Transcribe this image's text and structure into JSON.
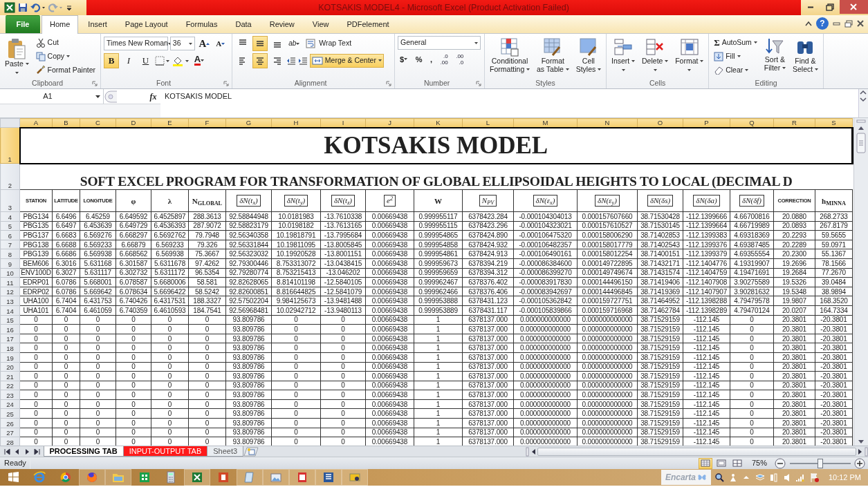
{
  "title_bar": {
    "title": "KOTSAKIS MODEL4  -  Microsoft Excel (Product Activation Failed)"
  },
  "menu_tabs": [
    {
      "label": "File",
      "kind": "file",
      "selected": false
    },
    {
      "label": "Home",
      "kind": "tab",
      "selected": true
    },
    {
      "label": "Insert",
      "kind": "tab",
      "selected": false
    },
    {
      "label": "Page Layout",
      "kind": "tab",
      "selected": false
    },
    {
      "label": "Formulas",
      "kind": "tab",
      "selected": false
    },
    {
      "label": "Data",
      "kind": "tab",
      "selected": false
    },
    {
      "label": "Review",
      "kind": "tab",
      "selected": false
    },
    {
      "label": "View",
      "kind": "tab",
      "selected": false
    },
    {
      "label": "PDFelement",
      "kind": "tab",
      "selected": false
    }
  ],
  "ribbon": {
    "clipboard": {
      "label": "Clipboard",
      "paste": "Paste",
      "cut": "Cut",
      "copy": "Copy",
      "format_painter": "Format Painter"
    },
    "font": {
      "label": "Font",
      "font_name": "Times New Roman",
      "font_size": "36",
      "grow_glyph": "A",
      "shrink_glyph": "A",
      "bold_glyph": "B",
      "italic_glyph": "I",
      "underline_glyph": "U",
      "color_glyph": "A",
      "bold": true,
      "italic": false,
      "underline": false
    },
    "alignment": {
      "label": "Alignment",
      "vertical": [
        {
          "selected": false
        },
        {
          "selected": true
        },
        {
          "selected": false
        }
      ],
      "horizontal": [
        {
          "selected": false
        },
        {
          "selected": true
        },
        {
          "selected": false
        }
      ],
      "orientation_glyph": "ab",
      "wrap_text": "Wrap Text",
      "wrap_on": false,
      "merge_center": "Merge & Center",
      "merge_on": true
    },
    "number": {
      "label": "Number",
      "format": "General",
      "currency": "$",
      "percent": "%",
      "comma": ",",
      "increase_decimal": [
        ".0",
        ".00"
      ],
      "decrease_decimal": [
        ".00",
        ".0"
      ]
    },
    "styles": {
      "label": "Styles",
      "buttons": [
        [
          "Conditional",
          "Formatting"
        ],
        [
          "Format",
          "as Table"
        ],
        [
          "Cell",
          "Styles"
        ]
      ]
    },
    "cells": {
      "label": "Cells",
      "buttons": [
        "Insert",
        "Delete",
        "Format"
      ]
    },
    "editing": {
      "label": "Editing",
      "autosum_glyph": "Σ",
      "autosum": "AutoSum",
      "fill": "Fill",
      "clear": "Clear",
      "sort": [
        "Sort &",
        "Filter"
      ],
      "find": [
        "Find &",
        "Select"
      ]
    }
  },
  "help": "?",
  "formula_bar": {
    "name_box": "A1",
    "function_glyph": "fx",
    "formula": "KOTSAKIS MODEL"
  },
  "columns": [
    {
      "letter": "A",
      "selected": true
    },
    {
      "letter": "B",
      "selected": true
    },
    {
      "letter": "C",
      "selected": true
    },
    {
      "letter": "D",
      "selected": true
    },
    {
      "letter": "E",
      "selected": true
    },
    {
      "letter": "F",
      "selected": true
    },
    {
      "letter": "G",
      "selected": true
    },
    {
      "letter": "H",
      "selected": true
    },
    {
      "letter": "I",
      "selected": true
    },
    {
      "letter": "J",
      "selected": true
    },
    {
      "letter": "K",
      "selected": true
    },
    {
      "letter": "L",
      "selected": true
    },
    {
      "letter": "M",
      "selected": true
    },
    {
      "letter": "N",
      "selected": true
    },
    {
      "letter": "O",
      "selected": true
    },
    {
      "letter": "P",
      "selected": true
    },
    {
      "letter": "Q",
      "selected": true
    },
    {
      "letter": "R",
      "selected": true
    },
    {
      "letter": "S",
      "selected": true
    }
  ],
  "rows": [
    {
      "number": "1",
      "selected": true,
      "kind": "title",
      "text": "KOTSAKIS MODEL"
    },
    {
      "number": "2",
      "selected": false,
      "kind": "subtitle",
      "text": "SOFT EXCEL PROGRAM FOR TRANSFORMATION OF GLOBAL ELLIPSOIDAL  HEIGHTS TO LOCAL  (DECIMAL D"
    },
    {
      "number": "3",
      "selected": false,
      "kind": "header",
      "cells": [
        {
          "text": "STATION",
          "kind": "label"
        },
        {
          "text": "LATITUDE",
          "kind": "label"
        },
        {
          "text": "LONGITUDE",
          "kind": "label"
        },
        {
          "text": "φ",
          "kind": "symbol"
        },
        {
          "text": "λ",
          "kind": "symbol"
        },
        {
          "text": "N$_{GLOBAL}$",
          "kind": "symbol"
        },
        {
          "text": "δN(t$_{x}$)",
          "kind": "equation"
        },
        {
          "text": "δN(t$_{y}$)",
          "kind": "equation"
        },
        {
          "text": "δN(t$_{z}$)",
          "kind": "equation"
        },
        {
          "text": "e$^{2}$",
          "kind": "equation"
        },
        {
          "text": "W",
          "kind": "symbol"
        },
        {
          "text": "N$_{PV}$",
          "kind": "equation"
        },
        {
          "text": "δN(ε$_{x}$)",
          "kind": "equation"
        },
        {
          "text": "δN(ε$_{y}$)",
          "kind": "equation"
        },
        {
          "text": "δN(δs)",
          "kind": "equation"
        },
        {
          "text": "δN(δa)",
          "kind": "equation"
        },
        {
          "text": "δN(δf)",
          "kind": "equation"
        },
        {
          "text": "CORRECTION",
          "kind": "label"
        },
        {
          "text": "h$_{MINNA}$",
          "kind": "symbol"
        }
      ]
    },
    {
      "number": "4",
      "selected": false,
      "kind": "data",
      "cells": [
        "PBG134",
        "6.6496",
        "6.45259",
        "6.649592",
        "6.4525897",
        "288.3613",
        "92.58844948",
        "10.0181983",
        "-13.7610338",
        "0.00669438",
        "0.999955117",
        "6378423.284",
        "-0.000104304013",
        "0.000157607660",
        "38.71530428",
        "-112.1399666",
        "4.66700816",
        "20.0880",
        "268.2733"
      ]
    },
    {
      "number": "5",
      "selected": false,
      "kind": "data",
      "cells": [
        "PBG135",
        "6.6497",
        "6.453639",
        "6.649729",
        "6.4536393",
        "287.9072",
        "92.58823179",
        "10.0198182",
        "-13.7613165",
        "0.00669438",
        "0.999955115",
        "6378423.296",
        "-0.000104323021",
        "0.000157610527",
        "38.71530145",
        "-112.1399664",
        "4.66719989",
        "20.0893",
        "267.8179"
      ]
    },
    {
      "number": "6",
      "selected": false,
      "kind": "data",
      "cells": [
        "PBG137",
        "6.6683",
        "6.569276",
        "6.668297",
        "6.5692762",
        "79.7948",
        "92.56340358",
        "10.19818791",
        "-13.7995684",
        "0.00669438",
        "0.999954865",
        "6378424.890",
        "-0.000106475320",
        "0.000158006290",
        "38.71402853",
        "-112.1399383",
        "4.69318369",
        "20.2293",
        "59.5655"
      ]
    },
    {
      "number": "7",
      "selected": false,
      "kind": "data",
      "cells": [
        "PBG138",
        "6.6688",
        "6.569233",
        "6.66879",
        "6.569233",
        "79.326",
        "92.56331844",
        "10.19811095",
        "-13.8005845",
        "0.00669438",
        "0.999954858",
        "6378424.932",
        "-0.000106482357",
        "0.000158017779",
        "38.71402543",
        "-112.1399376",
        "4.69387485",
        "20.2289",
        "59.0971"
      ]
    },
    {
      "number": "8",
      "selected": false,
      "kind": "data",
      "cells": [
        "PBG139",
        "6.6686",
        "6.569938",
        "6.668562",
        "6.569938",
        "75.3667",
        "92.56323032",
        "10.19920528",
        "-13.8001151",
        "0.00669438",
        "0.999954861",
        "6378424.913",
        "-0.000106490161",
        "0.000158012254",
        "38.71400151",
        "-112.1399379",
        "4.69355554",
        "20.2300",
        "55.1367"
      ]
    },
    {
      "number": "9",
      "selected": false,
      "kind": "data",
      "cells": [
        "BEM606",
        "6.3016",
        "5.631168",
        "6.301587",
        "5.6311678",
        "97.4262",
        "92.79300446",
        "8.753313072",
        "-13.0438415",
        "0.00669438",
        "0.999959673",
        "6378394.219",
        "-0.000086384600",
        "0.000149722895",
        "38.71432171",
        "-112.1404776",
        "4.19319907",
        "19.2696",
        "78.1566"
      ]
    },
    {
      "number": "10",
      "selected": false,
      "kind": "data",
      "cells": [
        "ENV100D",
        "6.3027",
        "5.631117",
        "6.302732",
        "5.6311172",
        "96.5354",
        "92.79280774",
        "8.753215413",
        "-13.046202",
        "0.00669438",
        "0.999959659",
        "6378394.312",
        "-0.000086399270",
        "0.000149749674",
        "38.71431574",
        "-112.1404759",
        "4.19471691",
        "19.2684",
        "77.2670"
      ]
    },
    {
      "number": "11",
      "selected": false,
      "kind": "data",
      "cells": [
        "EDRP01",
        "6.0786",
        "5.668001",
        "6.078587",
        "5.6680006",
        "58.581",
        "92.82628065",
        "8.814101198",
        "-12.5840105",
        "0.00669438",
        "0.999962467",
        "6378376.402",
        "-0.000083917830",
        "0.000144496150",
        "38.71419406",
        "-112.1407908",
        "3.90275589",
        "19.5326",
        "39.0484"
      ]
    },
    {
      "number": "12",
      "selected": false,
      "kind": "data",
      "cells": [
        "EDRP02",
        "6.0786",
        "5.669642",
        "6.078634",
        "5.6696422",
        "58.5242",
        "92.82600851",
        "8.816644825",
        "-12.5841079",
        "0.00669438",
        "0.999962466",
        "6378376.406",
        "-0.000083942697",
        "0.000144496845",
        "38.71419369",
        "-112.1407907",
        "3.90281632",
        "19.5348",
        "38.9894"
      ]
    },
    {
      "number": "13",
      "selected": false,
      "kind": "data",
      "cells": [
        "UHA100",
        "6.7404",
        "6.431753",
        "6.740426",
        "6.4317531",
        "188.3327",
        "92.57502204",
        "9.984125673",
        "-13.9481488",
        "0.00669438",
        "0.999953888",
        "6378431.123",
        "-0.000105362842",
        "0.000159727751",
        "38.71464952",
        "-112.1398288",
        "4.79479578",
        "19.9807",
        "168.3520"
      ]
    },
    {
      "number": "14",
      "selected": false,
      "kind": "data",
      "cells": [
        "UHA101",
        "6.7404",
        "6.461059",
        "6.740359",
        "6.4610593",
        "184.7541",
        "92.56968481",
        "10.02942712",
        "-13.9480113",
        "0.00669438",
        "0.999953889",
        "6378431.117",
        "-0.000105839866",
        "0.000159716968",
        "38.71462784",
        "-112.1398289",
        "4.79470124",
        "20.0207",
        "164.7334"
      ]
    },
    {
      "number": "15",
      "selected": false,
      "kind": "data",
      "cells": [
        "0",
        "0",
        "0",
        "0",
        "0",
        "0",
        "93.809786",
        "0",
        "0",
        "0.00669438",
        "1",
        "6378137.000",
        "0.000000000000",
        "0.000000000000",
        "38.71529159",
        "-112.145",
        "0",
        "20.3801",
        "-20.3801"
      ]
    },
    {
      "number": "16",
      "selected": false,
      "kind": "data",
      "cells": [
        "0",
        "0",
        "0",
        "0",
        "0",
        "0",
        "93.809786",
        "0",
        "0",
        "0.00669438",
        "1",
        "6378137.000",
        "0.000000000000",
        "0.000000000000",
        "38.71529159",
        "-112.145",
        "0",
        "20.3801",
        "-20.3801"
      ]
    },
    {
      "number": "17",
      "selected": false,
      "kind": "data",
      "cells": [
        "0",
        "0",
        "0",
        "0",
        "0",
        "0",
        "93.809786",
        "0",
        "0",
        "0.00669438",
        "1",
        "6378137.000",
        "0.000000000000",
        "0.000000000000",
        "38.71529159",
        "-112.145",
        "0",
        "20.3801",
        "-20.3801"
      ]
    },
    {
      "number": "18",
      "selected": false,
      "kind": "data",
      "cells": [
        "0",
        "0",
        "0",
        "0",
        "0",
        "0",
        "93.809786",
        "0",
        "0",
        "0.00669438",
        "1",
        "6378137.000",
        "0.000000000000",
        "0.000000000000",
        "38.71529159",
        "-112.145",
        "0",
        "20.3801",
        "-20.3801"
      ]
    },
    {
      "number": "19",
      "selected": false,
      "kind": "data",
      "cells": [
        "0",
        "0",
        "0",
        "0",
        "0",
        "0",
        "93.809786",
        "0",
        "0",
        "0.00669438",
        "1",
        "6378137.000",
        "0.000000000000",
        "0.000000000000",
        "38.71529159",
        "-112.145",
        "0",
        "20.3801",
        "-20.3801"
      ]
    },
    {
      "number": "20",
      "selected": false,
      "kind": "data",
      "cells": [
        "0",
        "0",
        "0",
        "0",
        "0",
        "0",
        "93.809786",
        "0",
        "0",
        "0.00669438",
        "1",
        "6378137.000",
        "0.000000000000",
        "0.000000000000",
        "38.71529159",
        "-112.145",
        "0",
        "20.3801",
        "-20.3801"
      ]
    },
    {
      "number": "21",
      "selected": false,
      "kind": "data",
      "cells": [
        "0",
        "0",
        "0",
        "0",
        "0",
        "0",
        "93.809786",
        "0",
        "0",
        "0.00669438",
        "1",
        "6378137.000",
        "0.000000000000",
        "0.000000000000",
        "38.71529159",
        "-112.145",
        "0",
        "20.3801",
        "-20.3801"
      ]
    },
    {
      "number": "22",
      "selected": false,
      "kind": "data",
      "cells": [
        "0",
        "0",
        "0",
        "0",
        "0",
        "0",
        "93.809786",
        "0",
        "0",
        "0.00669438",
        "1",
        "6378137.000",
        "0.000000000000",
        "0.000000000000",
        "38.71529159",
        "-112.145",
        "0",
        "20.3801",
        "-20.3801"
      ]
    },
    {
      "number": "23",
      "selected": false,
      "kind": "data",
      "cells": [
        "0",
        "0",
        "0",
        "0",
        "0",
        "0",
        "93.809786",
        "0",
        "0",
        "0.00669438",
        "1",
        "6378137.000",
        "0.000000000000",
        "0.000000000000",
        "38.71529159",
        "-112.145",
        "0",
        "20.3801",
        "-20.3801"
      ]
    },
    {
      "number": "24",
      "selected": false,
      "kind": "data",
      "cells": [
        "0",
        "0",
        "0",
        "0",
        "0",
        "0",
        "93.809786",
        "0",
        "0",
        "0.00669438",
        "1",
        "6378137.000",
        "0.000000000000",
        "0.000000000000",
        "38.71529159",
        "-112.145",
        "0",
        "20.3801",
        "-20.3801"
      ]
    },
    {
      "number": "25",
      "selected": false,
      "kind": "data",
      "cells": [
        "0",
        "0",
        "0",
        "0",
        "0",
        "0",
        "93.809786",
        "0",
        "0",
        "0.00669438",
        "1",
        "6378137.000",
        "0.000000000000",
        "0.000000000000",
        "38.71529159",
        "-112.145",
        "0",
        "20.3801",
        "-20.3801"
      ]
    },
    {
      "number": "26",
      "selected": false,
      "kind": "data",
      "cells": [
        "0",
        "0",
        "0",
        "0",
        "0",
        "0",
        "93.809786",
        "0",
        "0",
        "0.00669438",
        "1",
        "6378137.000",
        "0.000000000000",
        "0.000000000000",
        "38.71529159",
        "-112.145",
        "0",
        "20.3801",
        "-20.3801"
      ]
    },
    {
      "number": "27",
      "selected": false,
      "kind": "data",
      "cells": [
        "0",
        "0",
        "0",
        "0",
        "0",
        "0",
        "93.809786",
        "0",
        "0",
        "0.00669438",
        "1",
        "6378137.000",
        "0.000000000000",
        "0.000000000000",
        "38.71529159",
        "-112.145",
        "0",
        "20.3801",
        "-20.3801"
      ]
    },
    {
      "number": "28",
      "selected": false,
      "kind": "data",
      "cells": [
        "0",
        "0",
        "0",
        "0",
        "0",
        "0",
        "93.809786",
        "0",
        "0",
        "0.00669438",
        "1",
        "6378137.000",
        "0.000000000000",
        "0.000000000000",
        "38.71529159",
        "-112.145",
        "0",
        "20.3801",
        "-20.3801"
      ]
    }
  ],
  "sheet_tabs": [
    {
      "label": "PROCESSING TAB",
      "selected": true
    },
    {
      "label": "INPUT-OUTPUT TAB",
      "selected": false,
      "color": "#ff1a1a"
    },
    {
      "label": "Sheet3",
      "selected": false
    }
  ],
  "status_bar": {
    "status": "Ready",
    "views": [
      {
        "selected": true
      },
      {
        "selected": false
      },
      {
        "selected": false
      }
    ],
    "zoom": "75%",
    "zoom_level": {
      "level": 0.5
    }
  },
  "taskbar": {
    "apps": [
      {
        "running": false
      },
      {
        "running": false
      },
      {
        "running": true
      },
      {
        "running": true
      },
      {
        "running": false
      },
      {
        "running": false
      },
      {
        "running": true
      },
      {
        "running": false
      },
      {
        "running": true
      },
      {
        "running": true
      },
      {
        "running": true
      },
      {
        "running": true
      },
      {
        "running": true
      }
    ],
    "search_logo": "Encarta",
    "clock": "10:12 PM"
  }
}
